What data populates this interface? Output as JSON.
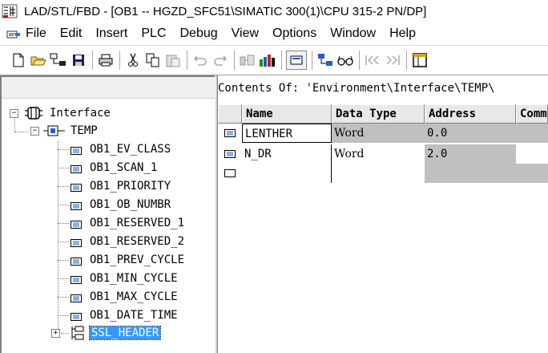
{
  "window": {
    "title": "LAD/STL/FBD  - [OB1 -- HGZD_SFC51\\SIMATIC 300(1)\\CPU 315-2 PN/DP]"
  },
  "menu": {
    "items": [
      "File",
      "Edit",
      "Insert",
      "PLC",
      "Debug",
      "View",
      "Options",
      "Window",
      "Help"
    ]
  },
  "toolbar": {
    "icons": [
      "new-icon",
      "open-icon",
      "accessible-nodes-icon",
      "save-icon",
      "print-icon",
      "cut-icon",
      "copy-icon",
      "paste-icon",
      "undo-icon",
      "redo-icon",
      "download-icon",
      "monitor-icon",
      "overview-icon",
      "online-icon",
      "glasses-icon",
      "back-icon",
      "forward-icon",
      "window-icon"
    ]
  },
  "tree": {
    "root": "Interface",
    "temp": "TEMP",
    "vars": [
      "OB1_EV_CLASS",
      "OB1_SCAN_1",
      "OB1_PRIORITY",
      "OB1_OB_NUMBR",
      "OB1_RESERVED_1",
      "OB1_RESERVED_2",
      "OB1_PREV_CYCLE",
      "OB1_MIN_CYCLE",
      "OB1_MAX_CYCLE",
      "OB1_DATE_TIME"
    ],
    "selected": "SSL_HEADER"
  },
  "contents": {
    "label": "Contents Of: 'Environment\\Interface\\TEMP\\"
  },
  "table": {
    "columns": [
      "Name",
      "Data Type",
      "Address",
      "Comment"
    ],
    "rows": [
      {
        "name": "LENTHER",
        "type": "Word",
        "address": "0.0",
        "comment": ""
      },
      {
        "name": "N_DR",
        "type": "Word",
        "address": "2.0",
        "comment": ""
      },
      {
        "name": "",
        "type": "",
        "address": "",
        "comment": ""
      }
    ]
  },
  "colors": {
    "selection": "#3399ff",
    "grid_gray": "#c0c0c0"
  }
}
